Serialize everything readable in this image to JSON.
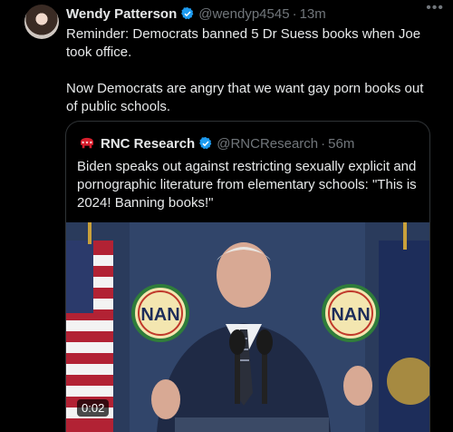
{
  "author": {
    "name": "Wendy Patterson",
    "handle": "@wendyp4545",
    "time": "13m"
  },
  "tweet_paragraphs": [
    "Reminder: Democrats banned 5 Dr Suess books when Joe took office.",
    "Now Democrats are angry that we want gay porn books out of public schools."
  ],
  "quoted": {
    "name": "RNC Research",
    "handle": "@RNCResearch",
    "time": "56m",
    "text": "Biden speaks out against restricting sexually explicit and pornographic literature from elementary schools: \"This is 2024! Banning books!\"",
    "video": {
      "logo_text_left": "NAN",
      "logo_text_right": "NAN",
      "duration": "0:02"
    }
  },
  "separator": "·",
  "icons": [
    "verified-badge-icon",
    "more-options-icon",
    "rnc-elephant-icon"
  ],
  "colors": {
    "background": "#000000",
    "text": "#e7e9ea",
    "muted": "#71767b",
    "verified": "#1d9bf0",
    "rnc_red": "#d81e2c"
  }
}
